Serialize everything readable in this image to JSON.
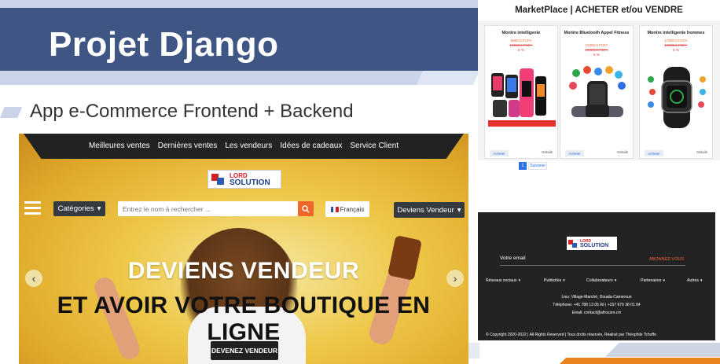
{
  "banner": {
    "title": "Projet Django",
    "subtitle": "App e-Commerce Frontend + Backend"
  },
  "colors": {
    "banner_blue": "#3f5583",
    "accent_orange": "#f0662a",
    "dark": "#232323",
    "stripe": "#c9d4e8"
  },
  "hero": {
    "nav": [
      "Meilleures ventes",
      "Dernières ventes",
      "Les vendeurs",
      "Idées de cadeaux",
      "Service Client"
    ],
    "logo": {
      "line1": "LORD",
      "line2": "SOLUTION"
    },
    "menu_icon": "hamburger-icon",
    "categories_label": "Catégories",
    "search_placeholder": "Entrez le nom à rechercher ...",
    "search_icon": "search-icon",
    "language_label": "Français",
    "become_seller_label": "Deviens Vendeur",
    "prev_icon": "chevron-left-icon",
    "next_icon": "chevron-right-icon",
    "line1": "DEVIENS VENDEUR",
    "line2": "ET AVOIR VOTRE BOUTIQUE EN LIGNE",
    "cta_label": "DEVENEZ VENDEUR"
  },
  "marketplace": {
    "title": "MarketPlace | ACHETER et/ou VENDRE",
    "products": [
      {
        "name": "Montre intelligente",
        "price": "6800.0 FCFA",
        "old_price": "15000.0 FCFA",
        "discount": "5 %",
        "buy_label": "Acheter",
        "details_label": "Détails"
      },
      {
        "name": "Montre Bluetooth Appel Fitness",
        "price": "12300.0 FCFA",
        "old_price": "16000.0 FCFA",
        "discount": "5 %",
        "buy_label": "Acheter",
        "details_label": "Détails"
      },
      {
        "name": "Montre intelligente hommes",
        "price": "17000.0 FCFA",
        "old_price": "18000.0 FCFA",
        "discount": "5 %",
        "buy_label": "Acheter",
        "details_label": "Détails"
      }
    ],
    "pager": {
      "current": "1",
      "next_label": "Suivante"
    }
  },
  "footer": {
    "logo": {
      "line1": "LORD",
      "line2": "SOLUTION"
    },
    "email_label": "Votre email",
    "subscribe_label": "ABONNEZ-VOUS",
    "menus": [
      "Réseaux sociaux",
      "Publicités",
      "Collaborateurs",
      "Partenaires",
      "Autres"
    ],
    "address": "Lieu: Village-Marché, Douala-Cameroun",
    "phone": "Téléphone: +41 788 13 05 66 | +237 679 38 01 84",
    "email": "Email: contact@afrocam.cm",
    "copyright": "© Copyright 2020-2022 | All Rights Reserved | Tous droits réservés, Réalisé par Théophile Tchoffo"
  }
}
